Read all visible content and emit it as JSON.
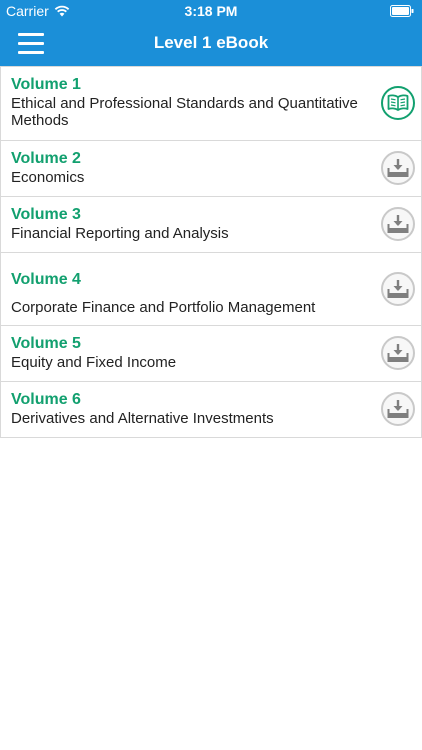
{
  "status_bar": {
    "carrier": "Carrier",
    "time": "3:18 PM"
  },
  "nav": {
    "title": "Level 1 eBook"
  },
  "colors": {
    "header": "#1b8fd8",
    "volume_title": "#12a06f",
    "divider": "#d9d9d9"
  },
  "volumes": [
    {
      "title": "Volume 1",
      "subtitle": "Ethical and Professional Standards and Quantitative Methods",
      "action_icon": "open-book-icon"
    },
    {
      "title": "Volume 2",
      "subtitle": "Economics",
      "action_icon": "download-icon"
    },
    {
      "title": "Volume 3",
      "subtitle": "Financial Reporting and Analysis",
      "action_icon": "download-icon"
    },
    {
      "title": "Volume 4",
      "subtitle": "Corporate Finance and Portfolio Management",
      "action_icon": "download-icon"
    },
    {
      "title": "Volume 5",
      "subtitle": "Equity and Fixed Income",
      "action_icon": "download-icon"
    },
    {
      "title": "Volume 6",
      "subtitle": "Derivatives and Alternative Investments",
      "action_icon": "download-icon"
    }
  ]
}
